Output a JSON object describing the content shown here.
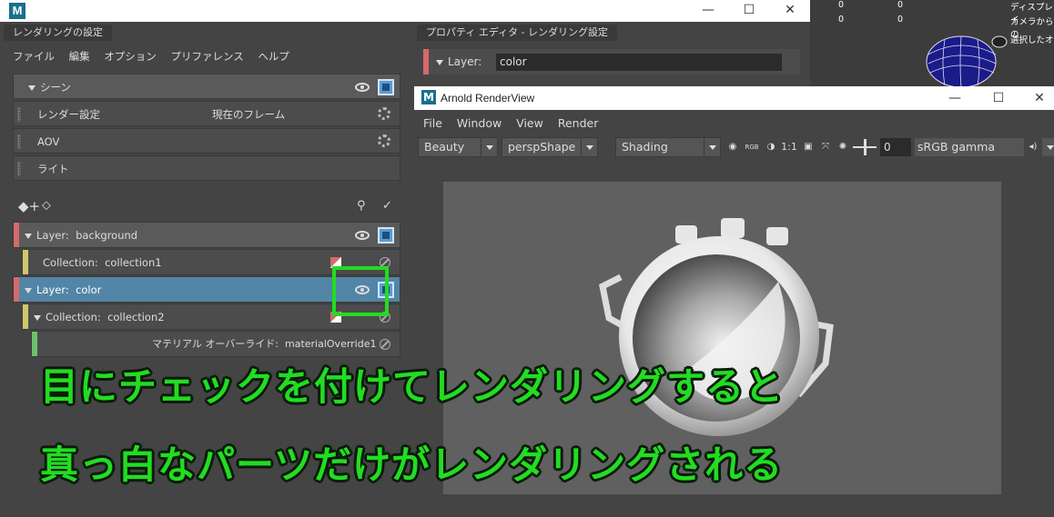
{
  "render_setup": {
    "panel_title": "レンダリングの設定",
    "menu": [
      "ファイル",
      "編集",
      "オプション",
      "プリファレンス",
      "ヘルプ"
    ],
    "scene_label": "シーン",
    "rows": [
      {
        "label": "レンダー設定",
        "value": "現在のフレーム"
      },
      {
        "label": "AOV",
        "value": ""
      },
      {
        "label": "ライト",
        "value": ""
      }
    ],
    "layers": [
      {
        "type": "Layer:",
        "name": "background",
        "color": "#d46a6a"
      },
      {
        "type": "Collection:",
        "name": "collection1",
        "color": "#cfc86a"
      },
      {
        "type": "Layer:",
        "name": "color",
        "color": "#d46a6a",
        "selected": true
      },
      {
        "type": "Collection:",
        "name": "collection2",
        "color": "#cfc86a"
      },
      {
        "type": "マテリアル オーバーライド:",
        "name": "materialOverride1",
        "color": "#6fbf6f"
      }
    ]
  },
  "property_editor": {
    "panel_title": "プロパティ エディタ - レンダリング設定",
    "layer_label": "Layer:",
    "layer_value": "color"
  },
  "viewport_hud": {
    "values": [
      "0",
      "0",
      "0",
      "0"
    ],
    "right_lines": [
      "ディスプレイ",
      "カメラからの",
      "選択したオ"
    ]
  },
  "arnold_renderview": {
    "title": "Arnold RenderView",
    "menu": [
      "File",
      "Window",
      "View",
      "Render"
    ],
    "aov_dropdown": "Beauty",
    "camera_dropdown": "perspShape",
    "shading_dropdown": "Shading",
    "ratio": "1:1",
    "exposure_value": "0",
    "color_space": "sRGB gamma",
    "rgb_icon": "RGB"
  },
  "captions": {
    "line1": "目にチェックを付けてレンダリングすると",
    "line2": "真っ白なパーツだけがレンダリングされる"
  },
  "colors": {
    "accent_green": "#22dd22",
    "selected_row": "#5285a6",
    "layer_red": "#d46a6a",
    "collection_yellow": "#cfc86a",
    "override_green": "#6fbf6f"
  },
  "icons": [
    "maya-logo-icon",
    "eye-icon",
    "render-icon",
    "gear-icon",
    "disable-icon",
    "minimize-icon",
    "maximize-icon",
    "close-icon"
  ]
}
